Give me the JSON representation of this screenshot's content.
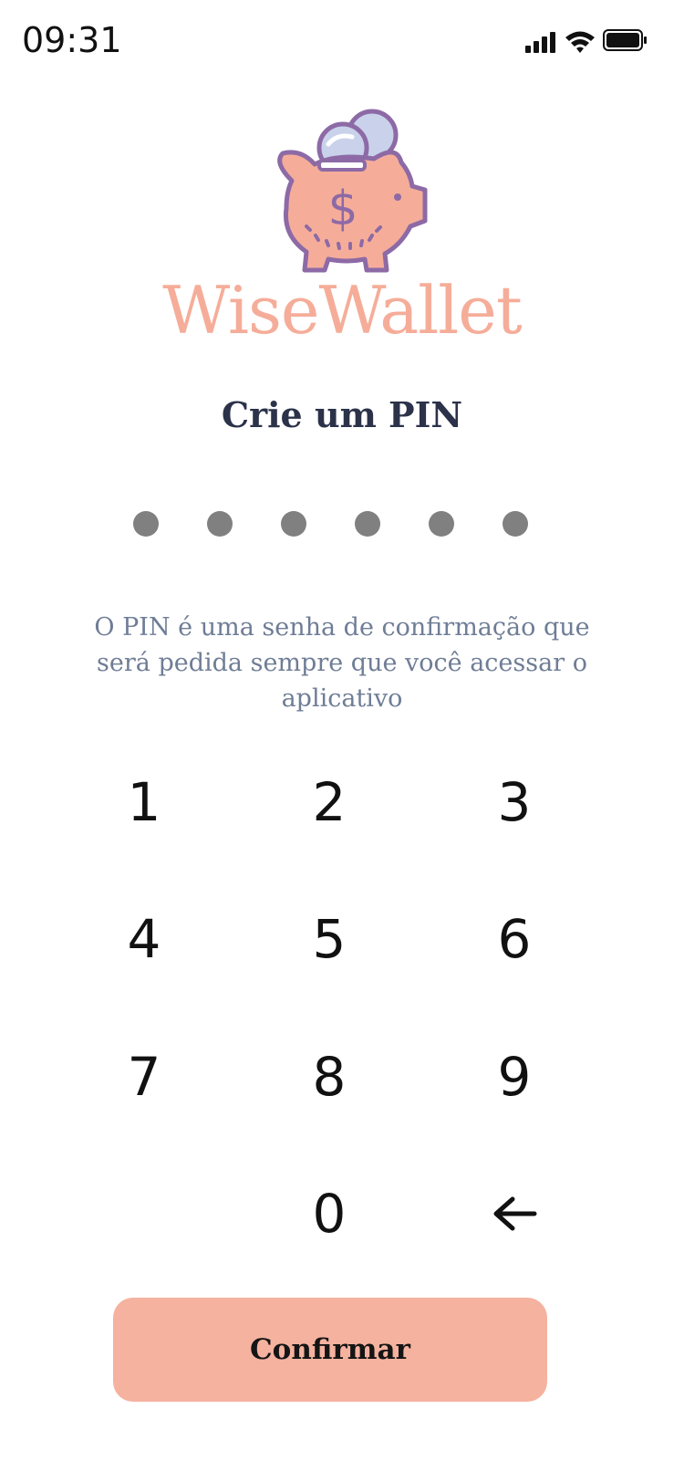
{
  "status_bar": {
    "time": "09:31",
    "icons": [
      "signal-icon",
      "wifi-icon",
      "battery-icon"
    ]
  },
  "brand": {
    "name": "WiseWallet",
    "logo_icon": "piggy-bank-icon",
    "color": "#f5ad99"
  },
  "pin": {
    "title": "Crie um PIN",
    "length": 6,
    "entered": 0,
    "hint": "O PIN é uma senha de confirmação que será pedida sempre que você acessar o aplicativo"
  },
  "keypad": {
    "keys": [
      "1",
      "2",
      "3",
      "4",
      "5",
      "6",
      "7",
      "8",
      "9",
      "",
      "0",
      "←"
    ],
    "backspace_icon": "arrow-left-icon"
  },
  "confirm_button": {
    "label": "Confirmar",
    "color": "#f5b29f"
  },
  "colors": {
    "title": "#2b3249",
    "hint": "#6f7d96",
    "dot": "#808080"
  }
}
